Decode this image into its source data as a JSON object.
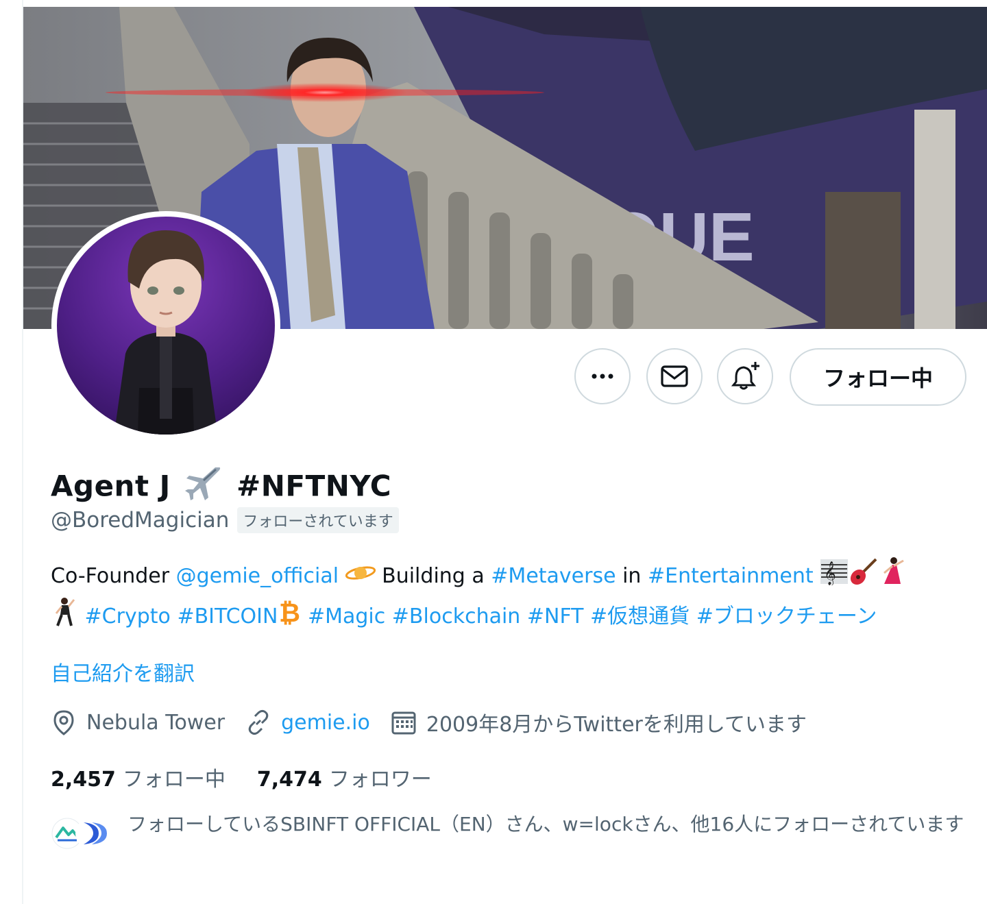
{
  "profile": {
    "name": "Agent J",
    "name_tag": "#NFTNYC",
    "handle": "@BoredMagician",
    "follows_you": "フォローされています"
  },
  "actions": {
    "follow_label": "フォロー中"
  },
  "bio": {
    "t1": "Co-Founder ",
    "m1": "@gemie_official",
    "t2": " Building a ",
    "h1": "#Metaverse",
    "t3": " in ",
    "h2": "#Entertainment",
    "h3": "#Crypto",
    "h4": "#BITCOIN",
    "h5": "#Magic",
    "h6": "#Blockchain",
    "h7": "#NFT",
    "h8": "#仮想通貨",
    "h9": "#ブロックチェーン"
  },
  "translate_label": "自己紹介を翻訳",
  "meta": {
    "location": "Nebula Tower",
    "website": "gemie.io",
    "joined": "2009年8月からTwitterを利用しています"
  },
  "counts": {
    "following_num": "2,457",
    "following_label": "フォロー中",
    "followers_num": "7,474",
    "followers_label": "フォロワー"
  },
  "followed_by_text": "フォローしているSBINFT OFFICIAL（EN）さん、w=lockさん、他16人にフォローされています",
  "icons": [
    "more-icon",
    "mail-icon",
    "bell-plus-icon",
    "location-icon",
    "link-icon",
    "calendar-icon",
    "airplane-icon",
    "saturn-icon",
    "music-score-icon",
    "guitar-icon",
    "dancer-icon",
    "man-dancing-icon",
    "bitcoin-icon"
  ],
  "colors": {
    "link": "#1d9bf0",
    "secondary_text": "#536471",
    "border": "#cfd9de"
  }
}
